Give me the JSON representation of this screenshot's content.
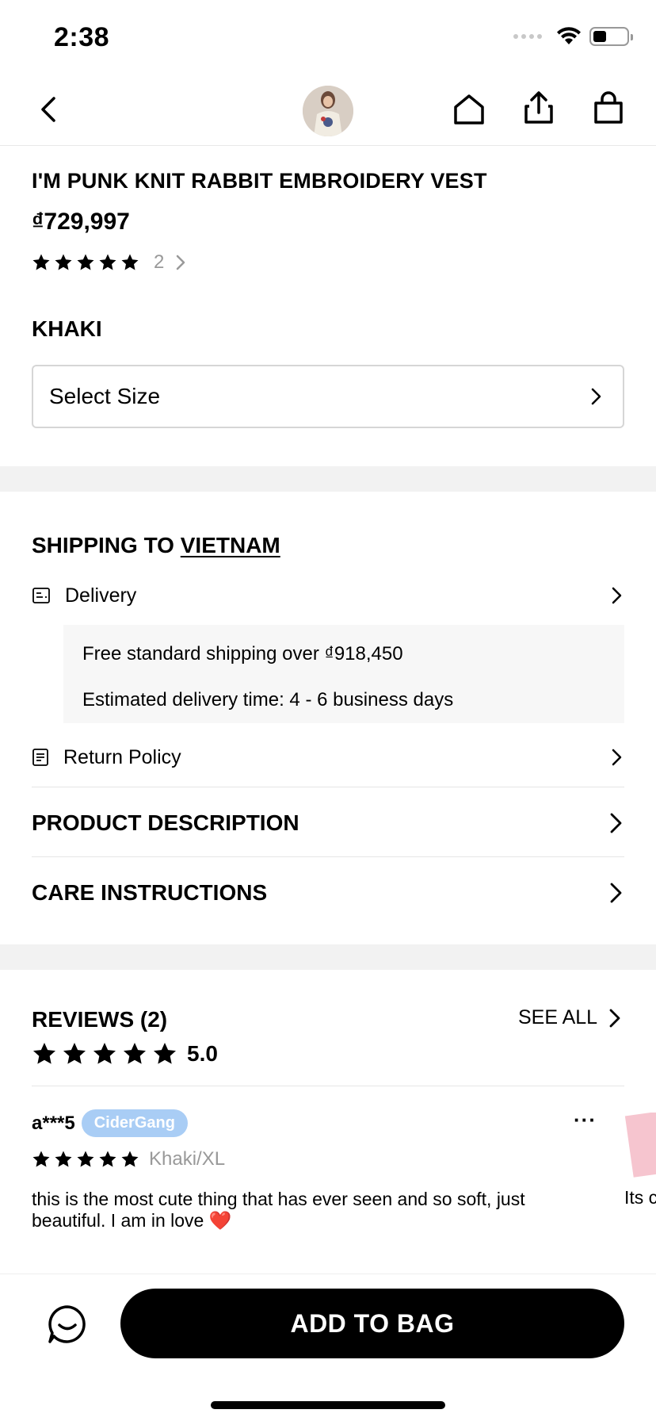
{
  "status_bar": {
    "time": "2:38"
  },
  "nav": {
    "back": "back-icon",
    "thumbnail": "product-thumbnail",
    "home": "home-icon",
    "share": "share-icon",
    "bag": "bag-icon"
  },
  "product": {
    "title": "I'M PUNK KNIT RABBIT EMBROIDERY VEST",
    "price": "₫729,997",
    "rating_stars": 5,
    "rating_count": "2",
    "color": "KHAKI",
    "size_placeholder": "Select Size"
  },
  "shipping": {
    "title_prefix": "SHIPPING TO",
    "country": "VIETNAM",
    "delivery_label": "Delivery",
    "free_shipping": "Free standard shipping over ₫918,450",
    "estimated_time": "Estimated delivery time: 4 - 6 business days",
    "return_label": "Return Policy"
  },
  "sections": {
    "description": "PRODUCT DESCRIPTION",
    "care": "CARE INSTRUCTIONS"
  },
  "reviews": {
    "title": "REVIEWS (2)",
    "see_all": "SEE ALL",
    "average": "5.0",
    "items": [
      {
        "user": "a***5",
        "badge": "CiderGang",
        "stars": 5,
        "variant": "Khaki/XL",
        "text": "this is the most cute thing that has ever seen and so soft, just beautiful. I am in love ❤️"
      }
    ],
    "peek_text": "Its c"
  },
  "bottom": {
    "add_to_bag": "ADD TO BAG"
  },
  "colors": {
    "badge": "#a9cdf5",
    "band": "#f2f2f2",
    "muted": "#999999"
  }
}
